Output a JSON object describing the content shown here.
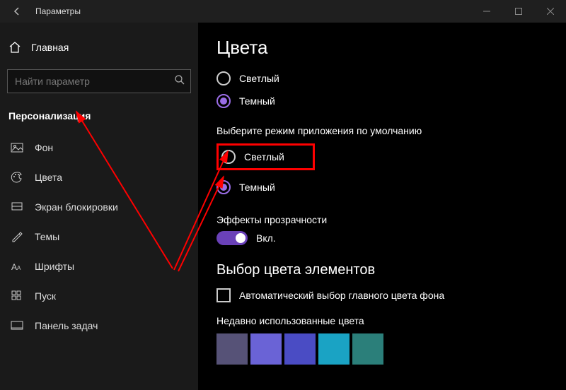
{
  "window": {
    "title": "Параметры"
  },
  "sidebar": {
    "home": "Главная",
    "search_placeholder": "Найти параметр",
    "section": "Персонализация",
    "items": [
      {
        "label": "Фон"
      },
      {
        "label": "Цвета"
      },
      {
        "label": "Экран блокировки"
      },
      {
        "label": "Темы"
      },
      {
        "label": "Шрифты"
      },
      {
        "label": "Пуск"
      },
      {
        "label": "Панель задач"
      }
    ]
  },
  "content": {
    "title": "Цвета",
    "windows_mode": {
      "light": "Светлый",
      "dark": "Темный"
    },
    "app_mode": {
      "label": "Выберите режим приложения по умолчанию",
      "light": "Светлый",
      "dark": "Темный"
    },
    "transparency": {
      "label": "Эффекты прозрачности",
      "state": "Вкл."
    },
    "accent": {
      "heading": "Выбор цвета элементов",
      "auto_checkbox": "Автоматический выбор главного цвета фона",
      "recent_label": "Недавно использованные цвета",
      "recent_colors": [
        "#565277",
        "#6a63d6",
        "#4a4cc4",
        "#1aa3c4",
        "#2b7f7a"
      ]
    }
  }
}
